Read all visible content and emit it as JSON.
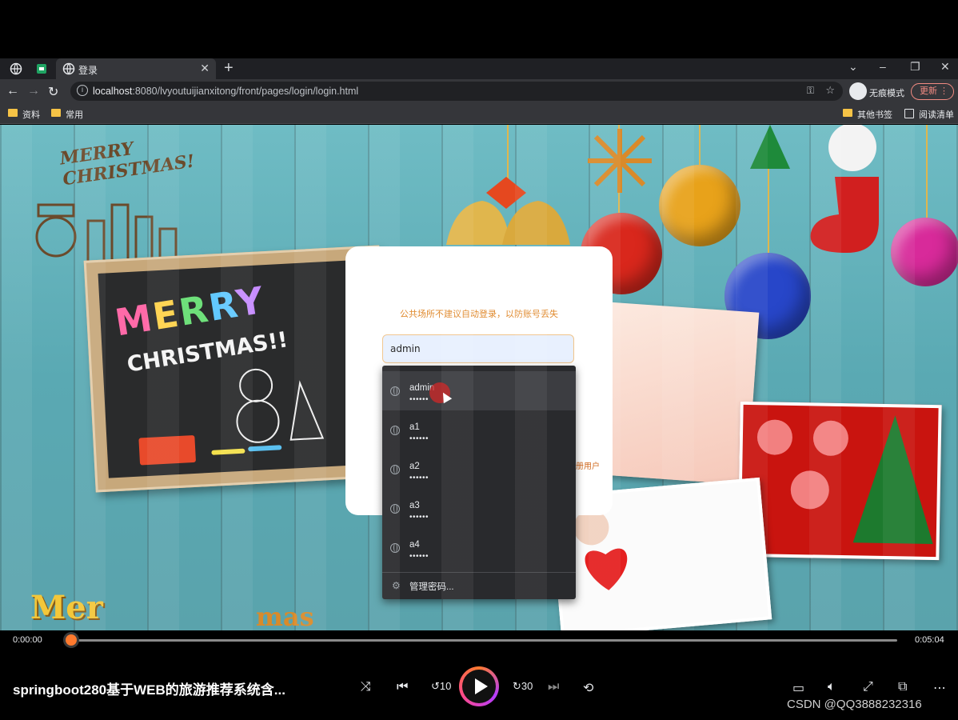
{
  "browser": {
    "tab_title": "登录",
    "url_host": "localhost",
    "url_rest": ":8080/lvyoutuijianxitong/front/pages/login/login.html",
    "incognito_label": "无痕模式",
    "update_label": "更新",
    "bookmarks": [
      "资料",
      "常用"
    ],
    "bookmarks_right": [
      "其他书签",
      "阅读清单"
    ]
  },
  "page": {
    "chalk_merry": "MERRY",
    "chalk_christmas": "CHRISTMAS!!",
    "login_tip": "公共场所不建议自动登录，以防账号丢失",
    "username_value": "admin",
    "register_link_fragment": "册用户",
    "bottom_merry": "Mer",
    "bottom_mas": "mas"
  },
  "autofill": {
    "entries": [
      {
        "user": "admin",
        "password": "••••••"
      },
      {
        "user": "a1",
        "password": "••••••"
      },
      {
        "user": "a2",
        "password": "••••••"
      },
      {
        "user": "a3",
        "password": "••••••"
      },
      {
        "user": "a4",
        "password": "••••••"
      }
    ],
    "manage_label": "管理密码..."
  },
  "player": {
    "elapsed": "0:00:00",
    "duration": "0:05:04",
    "progress": 0.0,
    "title": "springboot280基于WEB的旅游推荐系统含...",
    "watermark": "CSDN @QQ3888232316"
  },
  "colors": {
    "accent_orange": "#ff7a2e",
    "tip_orange": "#e08a2e",
    "dropdown_bg": "#292a2d"
  }
}
